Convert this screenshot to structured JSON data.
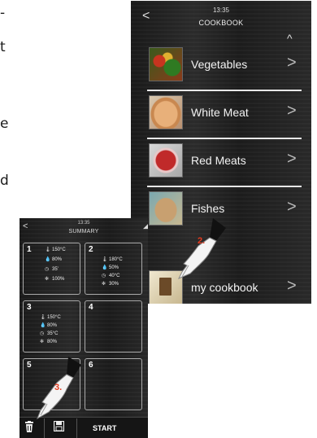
{
  "doc_fragments": [
    "-",
    "t",
    "e",
    "d"
  ],
  "cookbook": {
    "time": "13:35",
    "title": "COOKBOOK",
    "back_glyph": "<",
    "scroll_up_glyph": "^",
    "items": [
      {
        "label": "Vegetables",
        "icon": "vegetables-thumbnail"
      },
      {
        "label": "White Meat",
        "icon": "white-meat-thumbnail"
      },
      {
        "label": "Red Meats",
        "icon": "red-meat-thumbnail"
      },
      {
        "label": "Fishes",
        "icon": "fish-thumbnail"
      }
    ],
    "footer": {
      "label": "my cookbook",
      "icon": "book-thumbnail"
    },
    "chevron_glyph": ">"
  },
  "summary": {
    "time": "13:35",
    "title": "SUMMARY",
    "back_glyph": "<",
    "cells": [
      {
        "number": "1",
        "temperature": "150°C",
        "humidity": "80%",
        "time": "35'",
        "fan": "100%"
      },
      {
        "number": "2",
        "temperature": "180°C",
        "humidity": "50%",
        "time": "40°C",
        "fan": "30%"
      },
      {
        "number": "3",
        "temperature": "150°C",
        "humidity": "80%",
        "time": "35°C",
        "fan": "80%"
      },
      {
        "number": "4"
      },
      {
        "number": "5"
      },
      {
        "number": "6"
      }
    ],
    "start_label": "START"
  },
  "pointers": [
    {
      "label": "2.",
      "color": "#e63a1e"
    },
    {
      "label": "3.",
      "color": "#e63a1e"
    }
  ]
}
